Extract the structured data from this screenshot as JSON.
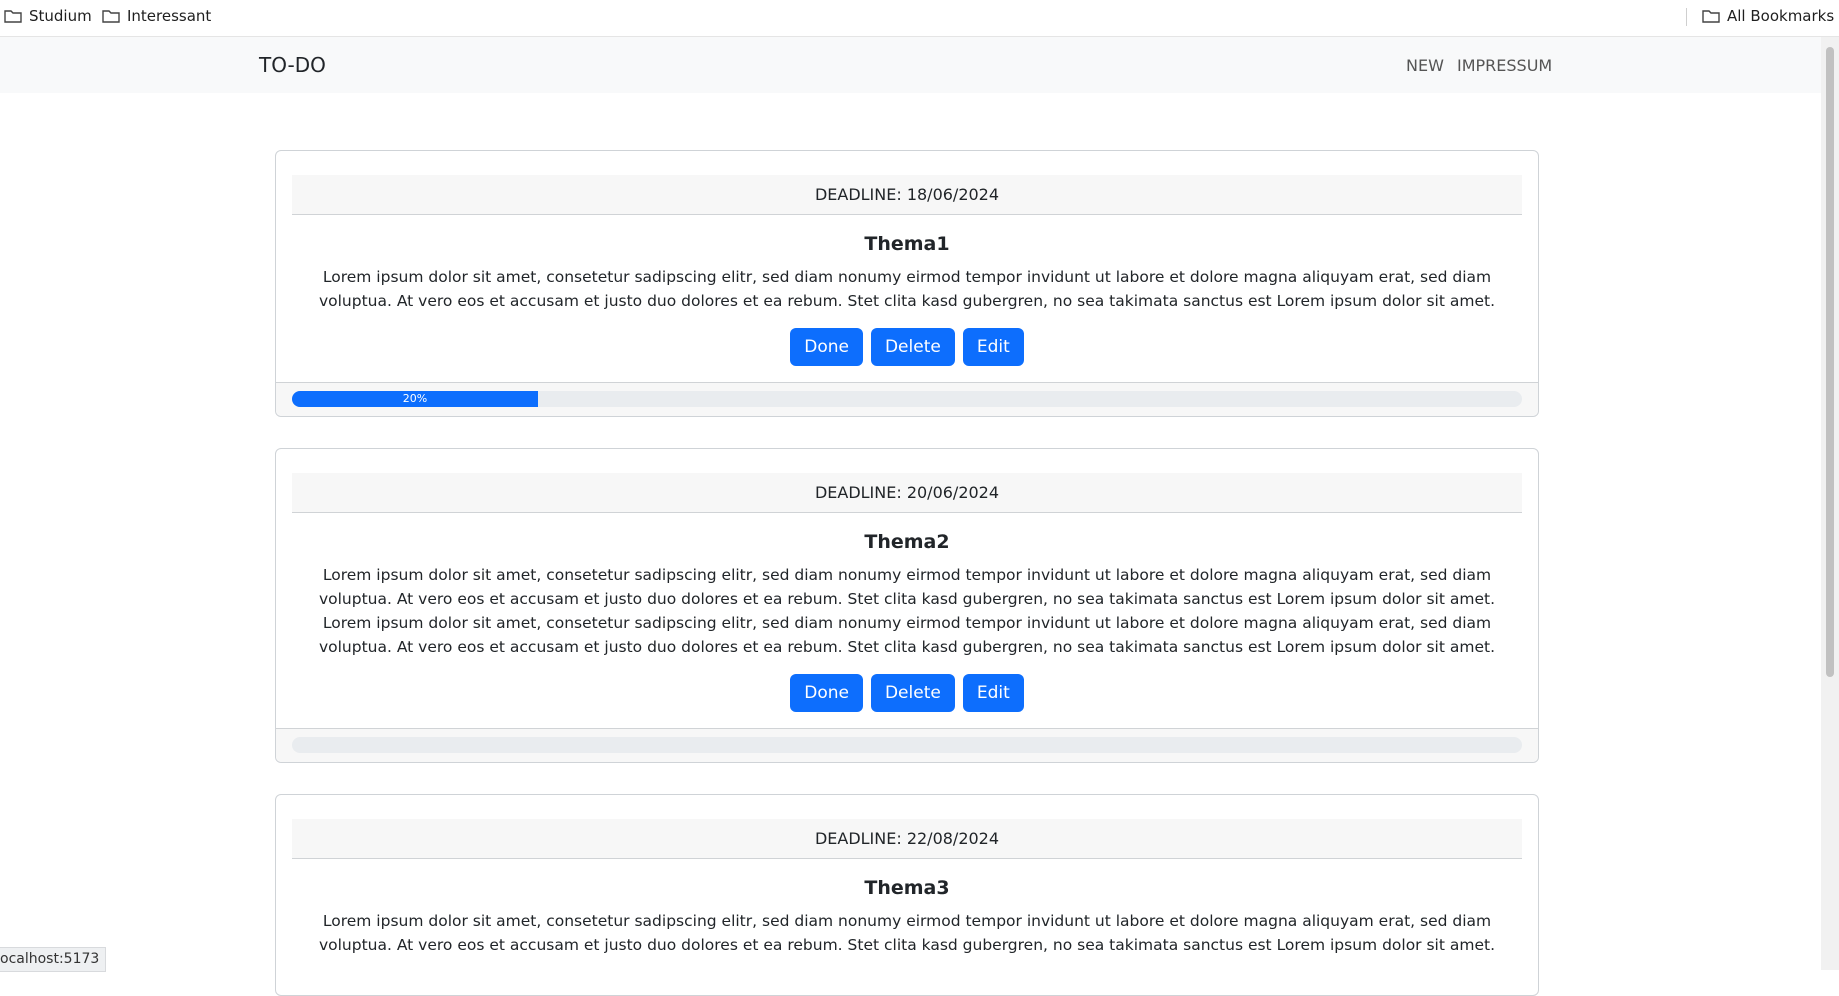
{
  "bookmarks": {
    "items": [
      {
        "label": "Studium"
      },
      {
        "label": "Interessant"
      }
    ],
    "all_label": "All Bookmarks"
  },
  "navbar": {
    "brand": "TO-DO",
    "links": [
      {
        "label": "NEW"
      },
      {
        "label": "IMPRESSUM"
      }
    ]
  },
  "todos": [
    {
      "deadline": "DEADLINE: 18/06/2024",
      "title": "Thema1",
      "text": "Lorem ipsum dolor sit amet, consetetur sadipscing elitr, sed diam nonumy eirmod tempor invidunt ut labore et dolore magna aliquyam erat, sed diam voluptua. At vero eos et accusam et justo duo dolores et ea rebum. Stet clita kasd gubergren, no sea takimata sanctus est Lorem ipsum dolor sit amet.",
      "buttons": {
        "done": "Done",
        "delete": "Delete",
        "edit": "Edit"
      },
      "progress": 20,
      "progress_label": "20%"
    },
    {
      "deadline": "DEADLINE: 20/06/2024",
      "title": "Thema2",
      "text": "Lorem ipsum dolor sit amet, consetetur sadipscing elitr, sed diam nonumy eirmod tempor invidunt ut labore et dolore magna aliquyam erat, sed diam voluptua. At vero eos et accusam et justo duo dolores et ea rebum. Stet clita kasd gubergren, no sea takimata sanctus est Lorem ipsum dolor sit amet. Lorem ipsum dolor sit amet, consetetur sadipscing elitr, sed diam nonumy eirmod tempor invidunt ut labore et dolore magna aliquyam erat, sed diam voluptua. At vero eos et accusam et justo duo dolores et ea rebum. Stet clita kasd gubergren, no sea takimata sanctus est Lorem ipsum dolor sit amet.",
      "buttons": {
        "done": "Done",
        "delete": "Delete",
        "edit": "Edit"
      },
      "progress": 0,
      "progress_label": ""
    },
    {
      "deadline": "DEADLINE: 22/08/2024",
      "title": "Thema3",
      "text": "Lorem ipsum dolor sit amet, consetetur sadipscing elitr, sed diam nonumy eirmod tempor invidunt ut labore et dolore magna aliquyam erat, sed diam voluptua. At vero eos et accusam et justo duo dolores et ea rebum. Stet clita kasd gubergren, no sea takimata sanctus est Lorem ipsum dolor sit amet."
    }
  ],
  "status_url": "ocalhost:5173",
  "colors": {
    "primary": "#0d6efd",
    "navbar_bg": "#f8f9fa",
    "card_header_bg": "#f7f7f7"
  }
}
